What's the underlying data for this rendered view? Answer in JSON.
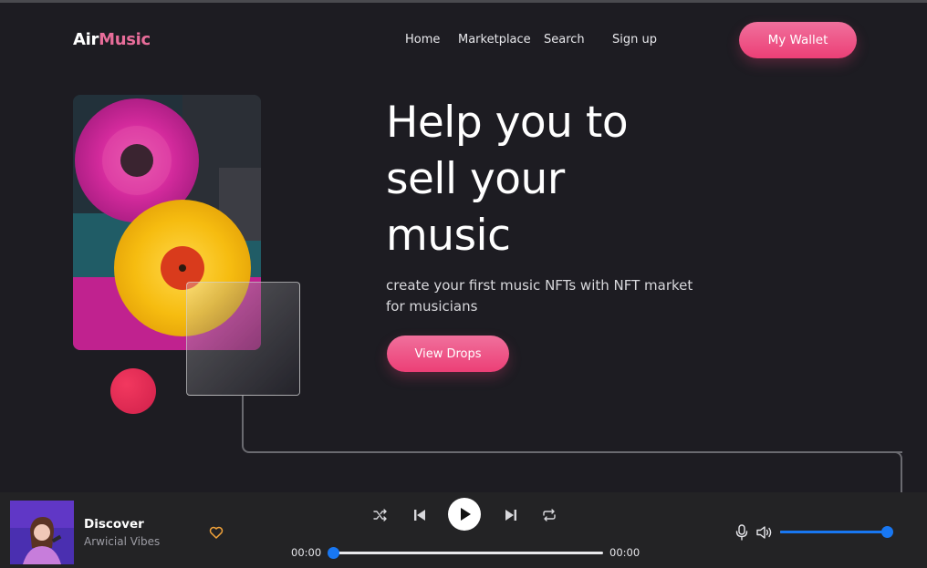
{
  "brand": {
    "part1": "Air",
    "part2": "Music"
  },
  "nav": {
    "items": [
      {
        "label": "Home"
      },
      {
        "label": "Marketplace"
      },
      {
        "label": "Search"
      },
      {
        "label": "Sign up"
      }
    ]
  },
  "wallet_label": "My Wallet",
  "hero": {
    "headline_line1": "Help you to",
    "headline_line2": "sell your",
    "headline_line3": "music",
    "subtext": "create your first music NFTs with NFT market for musicians",
    "cta_label": "View Drops"
  },
  "player": {
    "track_title": "Discover",
    "track_artist": "Arwicial Vibes",
    "time_current": "00:00",
    "time_total": "00:00",
    "progress": 0,
    "volume": 1.0
  },
  "colors": {
    "accent_pink": "#ec3f76",
    "brand_pink": "#e86d9a",
    "slider_blue": "#1877f2",
    "background": "#1d1c22"
  },
  "icons": [
    "shuffle-icon",
    "previous-icon",
    "play-icon",
    "next-icon",
    "repeat-icon",
    "heart-icon",
    "microphone-icon",
    "speaker-icon"
  ]
}
